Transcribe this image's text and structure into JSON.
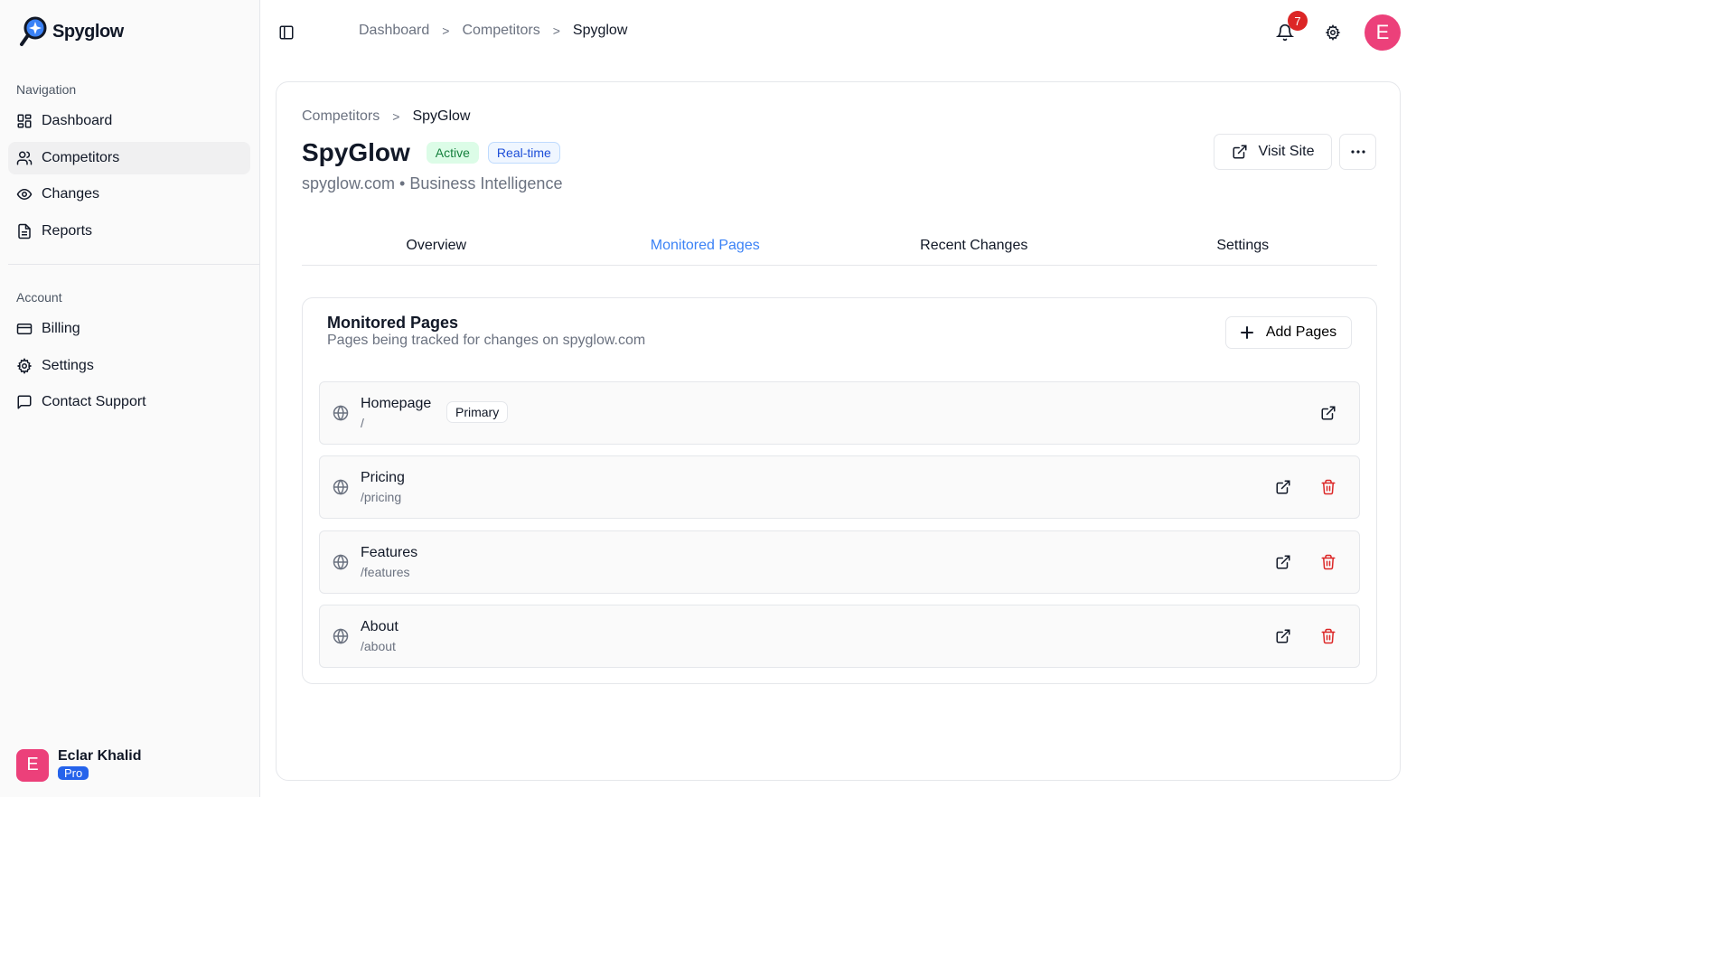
{
  "sidebar": {
    "logo_text": "Spyglow",
    "nav_heading": "Navigation",
    "nav_items": [
      {
        "label": "Dashboard",
        "icon": "grid-icon"
      },
      {
        "label": "Competitors",
        "icon": "users-icon",
        "active": true
      },
      {
        "label": "Changes",
        "icon": "eye-icon"
      },
      {
        "label": "Reports",
        "icon": "document-icon"
      }
    ],
    "account_heading": "Account",
    "account_items": [
      {
        "label": "Billing",
        "icon": "credit-card-icon"
      },
      {
        "label": "Settings",
        "icon": "gear-icon"
      },
      {
        "label": "Contact Support",
        "icon": "chat-icon"
      }
    ],
    "user": {
      "initial": "E",
      "name": "Eclar Khalid",
      "plan": "Pro"
    }
  },
  "topbar": {
    "breadcrumb": [
      "Dashboard",
      "Competitors",
      "Spyglow"
    ],
    "notification_count": "7",
    "avatar_initial": "E"
  },
  "competitor": {
    "breadcrumb": [
      "Competitors",
      "SpyGlow"
    ],
    "name": "SpyGlow",
    "status_badge": "Active",
    "mode_badge": "Real-time",
    "subtitle": "spyglow.com • Business Intelligence",
    "visit_label": "Visit Site"
  },
  "tabs": [
    {
      "label": "Overview"
    },
    {
      "label": "Monitored Pages",
      "active": true
    },
    {
      "label": "Recent Changes"
    },
    {
      "label": "Settings"
    }
  ],
  "monitored": {
    "title": "Monitored Pages",
    "description": "Pages being tracked for changes on spyglow.com",
    "add_label": "Add Pages",
    "pages": [
      {
        "name": "Homepage",
        "path": "/",
        "badge": "Primary"
      },
      {
        "name": "Pricing",
        "path": "/pricing"
      },
      {
        "name": "Features",
        "path": "/features"
      },
      {
        "name": "About",
        "path": "/about"
      }
    ]
  },
  "colors": {
    "accent": "#3b82f6",
    "avatar": "#ec407a",
    "danger": "#dc2626",
    "active_badge": "#15803d"
  }
}
